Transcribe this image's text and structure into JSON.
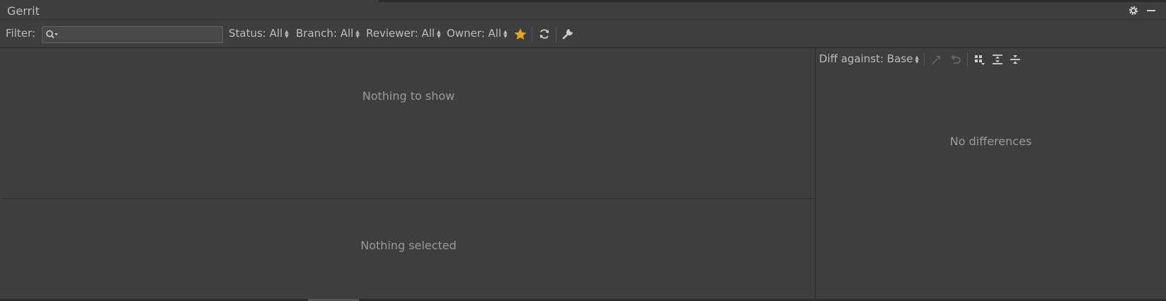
{
  "panel": {
    "title": "Gerrit"
  },
  "toolbar": {
    "filter_label": "Filter:",
    "filter_value": "",
    "status": "Status: All",
    "branch": "Branch: All",
    "reviewer": "Reviewer: All",
    "owner": "Owner: All"
  },
  "changes": {
    "empty_text": "Nothing to show",
    "details_empty_text": "Nothing selected"
  },
  "diff": {
    "against_label": "Diff against: Base",
    "empty_text": "No differences"
  },
  "colors": {
    "star": "#f0a30a",
    "background": "#3c3f41"
  },
  "icons": [
    "gear-icon",
    "minimize-icon",
    "search-icon",
    "star-icon",
    "refresh-icon",
    "wrench-icon",
    "compare-icon",
    "revert-icon",
    "group-by-icon",
    "expand-all-icon",
    "collapse-all-icon"
  ]
}
